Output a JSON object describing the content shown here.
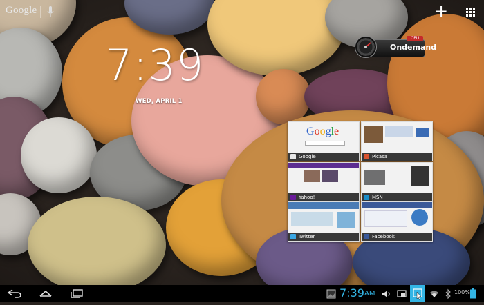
{
  "topbar": {
    "search_label": "Google",
    "mic_icon": "mic-icon",
    "add_icon": "plus-icon",
    "apps_icon": "apps-grid-icon"
  },
  "clock_widget": {
    "time": "7:39",
    "date": "WED, APRIL 1"
  },
  "cpu_widget": {
    "tag": "CPU",
    "governor": "Ondemand"
  },
  "recent_apps": [
    {
      "label": "Google",
      "icon_color": "#e7e7e7"
    },
    {
      "label": "Picasa",
      "icon_color": "#d8532f"
    },
    {
      "label": "Yahoo!",
      "icon_color": "#6a1b9a"
    },
    {
      "label": "MSN",
      "icon_color": "#1a8cc7"
    },
    {
      "label": "Twitter",
      "icon_color": "#3aa6e2"
    },
    {
      "label": "Facebook",
      "icon_color": "#3b5998"
    }
  ],
  "statusbar": {
    "time": "7:39",
    "ampm": "AM",
    "battery": "100%"
  },
  "colors": {
    "accent": "#33b5e5",
    "navbar": "#000000"
  }
}
